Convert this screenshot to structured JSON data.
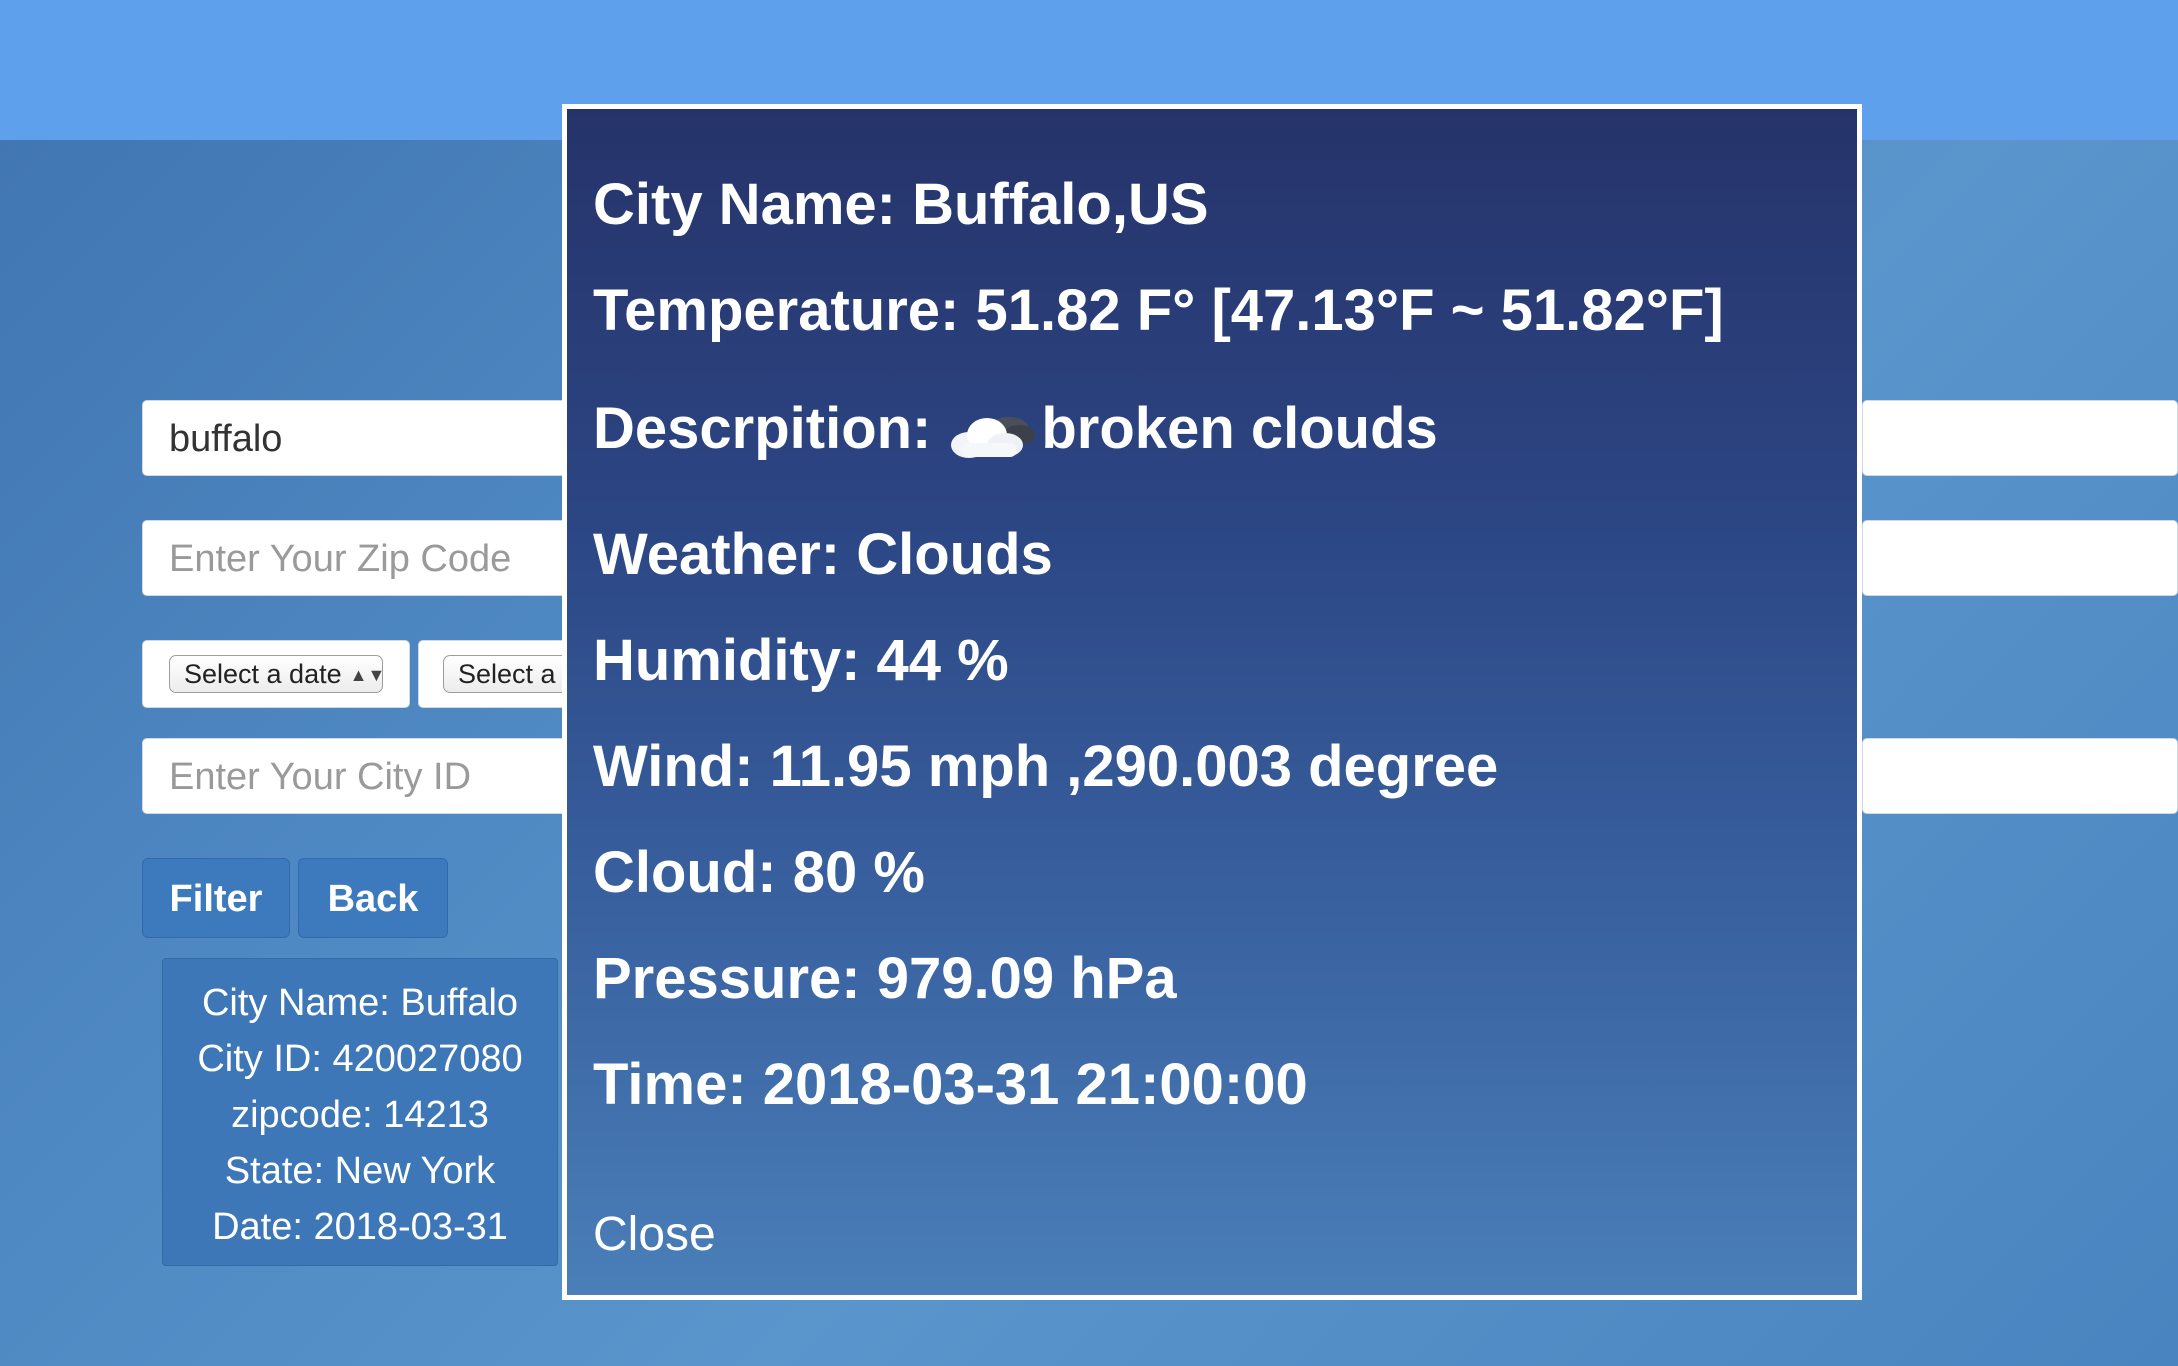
{
  "search": {
    "city_value": "buffalo",
    "zip_placeholder": "Enter Your Zip Code",
    "date_select_label": "Select a date",
    "second_select_label": "Select a",
    "cityid_placeholder": "Enter Your City ID"
  },
  "buttons": {
    "filter": "Filter",
    "back": "Back"
  },
  "result_card": {
    "lines": [
      "City Name: Buffalo",
      "City ID: 420027080",
      "zipcode: 14213",
      "State: New York",
      "Date: 2018-03-31"
    ]
  },
  "modal": {
    "city_name": "City Name: Buffalo,US",
    "temperature": "Temperature: 51.82 F° [47.13°F ~ 51.82°F]",
    "description_label": "Descrpition:",
    "description_value": "broken clouds",
    "description_icon": "cloud-icon",
    "weather": "Weather: Clouds",
    "humidity": "Humidity: 44 %",
    "wind": "Wind: 11.95 mph ,290.003 degree",
    "cloud": "Cloud: 80 %",
    "pressure": "Pressure: 979.09 hPa",
    "time": "Time: 2018-03-31 21:00:00",
    "close_label": "Close"
  },
  "colors": {
    "topbar": "#5fa0ec",
    "button": "#3d79bd",
    "modal_top": "#26336a",
    "modal_bottom": "#4a7fb8"
  }
}
